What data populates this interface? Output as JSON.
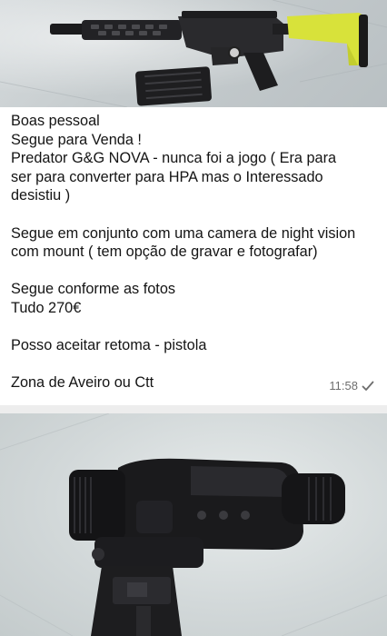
{
  "message": {
    "text": "Boas pessoal\nSegue para Venda !\nPredator G&G NOVA - nunca foi a jogo ( Era para\nser para converter para HPA mas o Interessado\ndesistiu )\n\nSegue em conjunto com uma camera de night vision\ncom mount ( tem opção de gravar e fotografar)\n\nSegue conforme as fotos\nTudo 270€\n\nPosso aceitar retoma - pistola\n\nZona de Aveiro ou Ctt",
    "time": "11:58",
    "status_icon": "single-check-icon"
  },
  "photos": [
    {
      "subject": "airsoft-rifle-photo"
    },
    {
      "subject": "night-vision-camera-photo"
    }
  ]
}
